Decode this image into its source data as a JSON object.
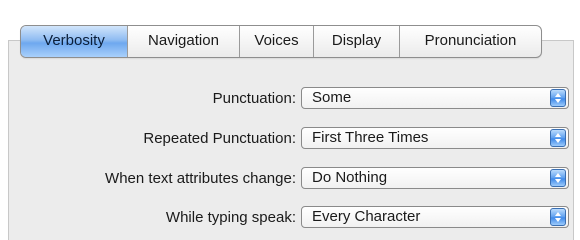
{
  "tabs": [
    "Verbosity",
    "Navigation",
    "Voices",
    "Display",
    "Pronunciation"
  ],
  "active_tab": "Verbosity",
  "settings": [
    {
      "label": "Punctuation:",
      "value": "Some"
    },
    {
      "label": "Repeated Punctuation:",
      "value": "First Three Times"
    },
    {
      "label": "When text attributes change:",
      "value": "Do Nothing"
    },
    {
      "label": "While typing speak:",
      "value": "Every Character"
    }
  ],
  "colors": {
    "active_tab": "#8fbcf2",
    "stepper": "#4a92ec",
    "panel_bg": "#ececec"
  },
  "icons": {
    "popup_arrows": "up-down-arrows-icon"
  }
}
